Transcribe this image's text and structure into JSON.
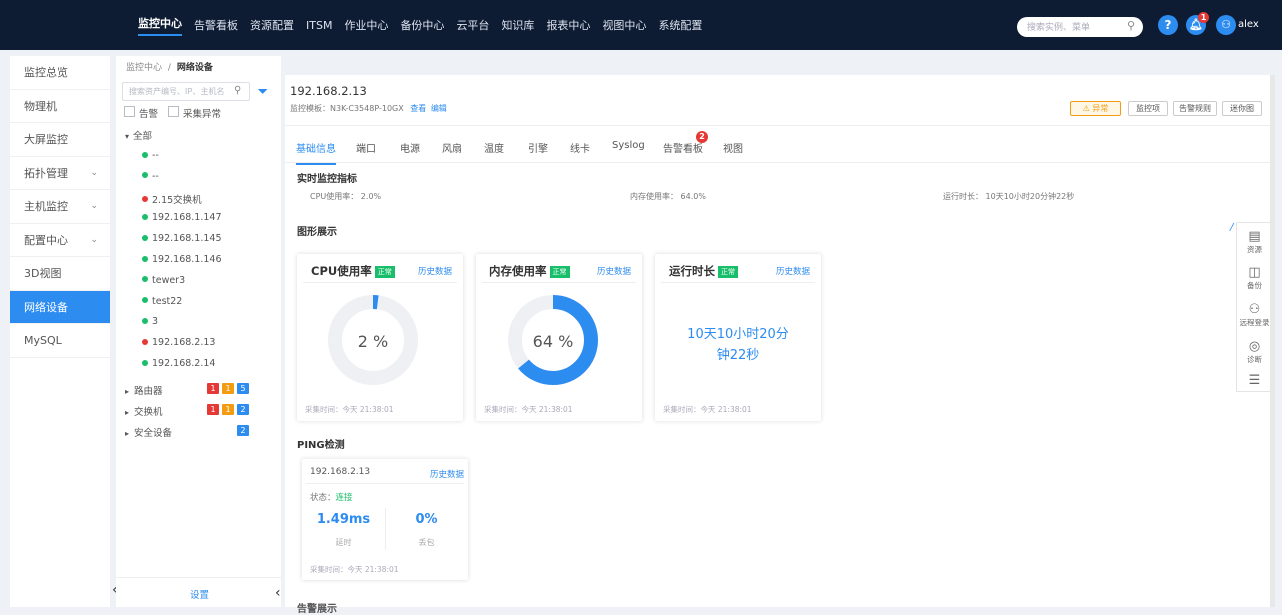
{
  "topnav": {
    "items": [
      "监控中心",
      "告警看板",
      "资源配置",
      "ITSM",
      "作业中心",
      "备份中心",
      "云平台",
      "知识库",
      "报表中心",
      "视图中心",
      "系统配置"
    ],
    "search_placeholder": "搜索实例、菜单",
    "help": "?",
    "bell_count": "1",
    "user": "alex"
  },
  "leftmenu": {
    "items": [
      {
        "label": "监控总览"
      },
      {
        "label": "物理机"
      },
      {
        "label": "大屏监控"
      },
      {
        "label": "拓扑管理",
        "chev": "⌄"
      },
      {
        "label": "主机监控",
        "chev": "⌄"
      },
      {
        "label": "配置中心",
        "chev": "⌄"
      },
      {
        "label": "3D视图"
      },
      {
        "label": "网络设备"
      },
      {
        "label": "MySQL"
      }
    ],
    "collapse": "‹"
  },
  "breadcrumb": {
    "root": "监控中心",
    "sep": "/",
    "current": "网络设备"
  },
  "tree": {
    "search_placeholder": "搜索资产编号、IP、主机名",
    "filter_alarm": "告警",
    "filter_collect": "采集异常",
    "root": "全部",
    "root_arrow": "▾",
    "nodes": [
      {
        "label": "--",
        "color": "#19be6b"
      },
      {
        "label": "--",
        "color": "#19be6b"
      },
      {
        "label": "2.15交换机",
        "color": "#e53935"
      },
      {
        "label": "192.168.1.147",
        "color": "#19be6b"
      },
      {
        "label": "192.168.1.145",
        "color": "#19be6b"
      },
      {
        "label": "192.168.1.146",
        "color": "#19be6b"
      },
      {
        "label": "tewer3",
        "color": "#19be6b"
      },
      {
        "label": "test22",
        "color": "#19be6b"
      },
      {
        "label": "3",
        "color": "#19be6b"
      },
      {
        "label": "192.168.2.13",
        "color": "#e53935"
      },
      {
        "label": "192.168.2.14",
        "color": "#19be6b"
      }
    ],
    "groups": [
      {
        "label": "路由器",
        "counts": [
          "1",
          "1",
          "5"
        ]
      },
      {
        "label": "交换机",
        "counts": [
          "1",
          "1",
          "2"
        ]
      },
      {
        "label": "安全设备",
        "counts": [
          "2"
        ]
      }
    ],
    "group_arrow": "▸",
    "settings": "设置",
    "collapse": "‹"
  },
  "device": {
    "ip": "192.168.2.13",
    "template_label": "监控模板：",
    "template": "N3K-C3548P-10GX",
    "view": "查看",
    "edit": "编辑"
  },
  "buttons": {
    "abnormal": "异常",
    "monitor_items": "监控项",
    "alarm_rules": "告警规则",
    "mini_map": "迷你图"
  },
  "tabs": [
    "基础信息",
    "端口",
    "电源",
    "风扇",
    "温度",
    "引擎",
    "线卡",
    "Syslog",
    "告警看板",
    "视图"
  ],
  "tab_badge": "2",
  "realtime": {
    "title": "实时监控指标",
    "cpu": "CPU使用率： 2.0%",
    "mem": "内存使用率： 64.0%",
    "uptime": "运行时长： 10天10小时20分钟22秒"
  },
  "graph_title": "图形展示",
  "cards": {
    "cpu": {
      "title": "CPU使用率",
      "status": "正常",
      "hist": "历史数据",
      "value": "2 %",
      "percent": 2,
      "footer": "采集时间：今天 21:38:01"
    },
    "mem": {
      "title": "内存使用率",
      "status": "正常",
      "hist": "历史数据",
      "value": "64 %",
      "percent": 64,
      "footer": "采集时间：今天 21:38:01"
    },
    "uptime": {
      "title": "运行时长",
      "status": "正常",
      "hist": "历史数据",
      "line1": "10天10小时20分",
      "line2": "钟22秒",
      "footer": "采集时间：今天 21:38:01"
    }
  },
  "ping": {
    "section": "PING检测",
    "ip": "192.168.2.13",
    "hist": "历史数据",
    "status_label": "状态：",
    "status": "连接",
    "latency": "1.49ms",
    "latency_label": "延时",
    "loss": "0%",
    "loss_label": "丢包",
    "footer": "采集时间：今天 21:38:01"
  },
  "bottom_title": "告警展示",
  "rightside": [
    {
      "icon": "▤",
      "label": "资源"
    },
    {
      "icon": "◫",
      "label": "备份"
    },
    {
      "icon": "⚇",
      "label": "远程登录"
    },
    {
      "icon": "◎",
      "label": "诊断"
    },
    {
      "icon": "☰",
      "label": ""
    }
  ],
  "colors": {
    "accent": "#2d8cf0",
    "ok": "#19be6b",
    "error": "#e53935",
    "warn": "#f39c12",
    "topbar": "#0d1b33"
  }
}
